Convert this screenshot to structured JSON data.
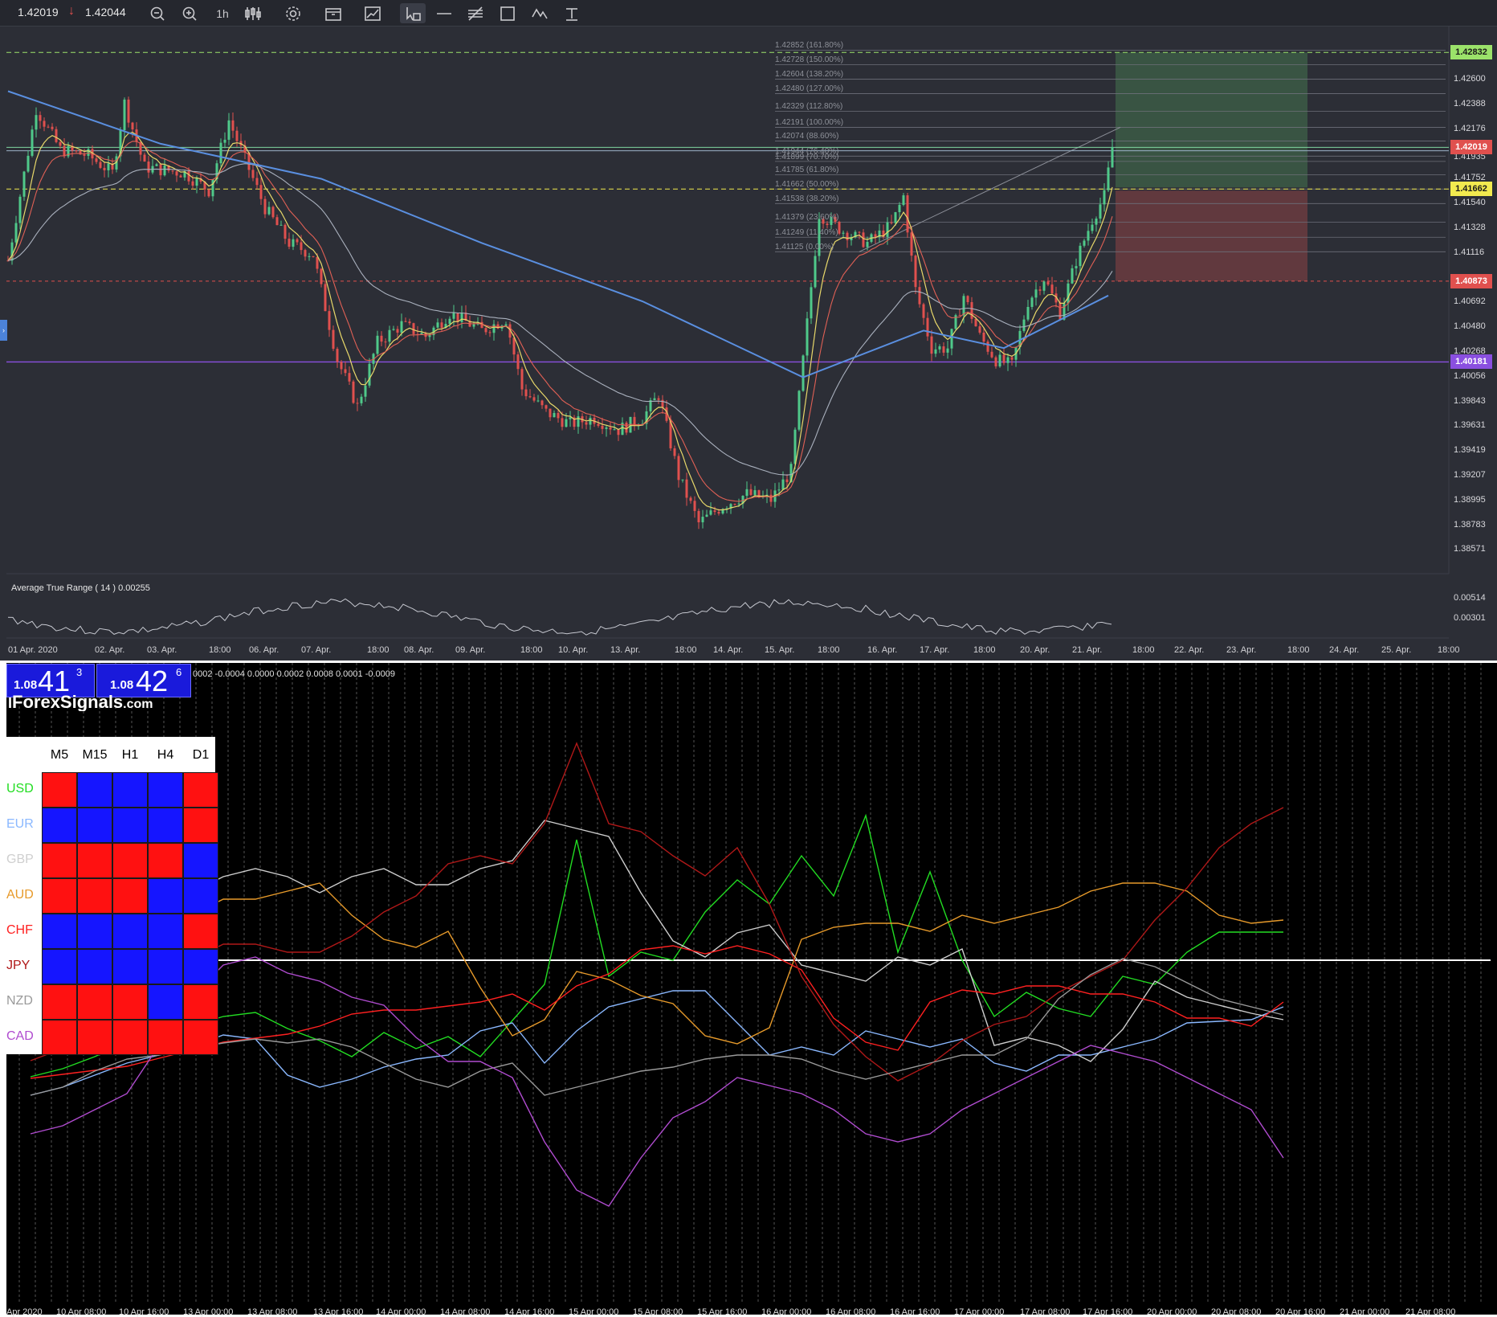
{
  "toolbar": {
    "bid": "1.42019",
    "ask": "1.42044",
    "timeframe": "1h",
    "icons": [
      "zoom-out-icon",
      "zoom-in-icon",
      "candles-icon",
      "settings-icon",
      "calendar-icon",
      "chart-image-icon",
      "cursor-icon",
      "horizontal-line-icon",
      "parallel-lines-icon",
      "rectangle-icon",
      "wave-icon",
      "text-icon"
    ]
  },
  "price_axis": [
    "1.42600",
    "1.42388",
    "1.42176",
    "1.41935",
    "1.41752",
    "1.41540",
    "1.41328",
    "1.41116",
    "1.40692",
    "1.40480",
    "1.40268",
    "1.40056",
    "1.39843",
    "1.39631",
    "1.39419",
    "1.39207",
    "1.38995",
    "1.38783",
    "1.38571"
  ],
  "price_tags": [
    {
      "value": "1.42832",
      "bg": "#9be26a",
      "fg": "#1a1a1a"
    },
    {
      "value": "1.42019",
      "bg": "#e0504e",
      "fg": "#ffffff"
    },
    {
      "value": "1.41662",
      "bg": "#f2ea4f",
      "fg": "#1a1a1a"
    },
    {
      "value": "1.40873",
      "bg": "#e0504e",
      "fg": "#ffffff"
    },
    {
      "value": "1.40181",
      "bg": "#8a4fe0",
      "fg": "#ffffff"
    }
  ],
  "fib_levels": [
    "1.42852 (161.80%)",
    "1.42728 (150.00%)",
    "1.42604 (138.20%)",
    "1.42480 (127.00%)",
    "1.42329 (112.80%)",
    "1.42191 (100.00%)",
    "1.42074 (88.60%)",
    "1.41944 (76.40%)",
    "1.41899 (70.70%)",
    "1.41785 (61.80%)",
    "1.41662 (50.00%)",
    "1.41538 (38.20%)",
    "1.41379 (23.60%)",
    "1.41249 (11.40%)",
    "1.41125 (0.00%)"
  ],
  "atr": {
    "title": "Average True Range ( 14 ) 0.00255",
    "axis": [
      "0.00514",
      "0.00301"
    ]
  },
  "date_axis": [
    "01 Apr. 2020",
    "02. Apr.",
    "03. Apr.",
    "18:00",
    "06. Apr.",
    "07. Apr.",
    "18:00",
    "08. Apr.",
    "09. Apr.",
    "18:00",
    "10. Apr.",
    "13. Apr.",
    "18:00",
    "14. Apr.",
    "15. Apr.",
    "18:00",
    "16. Apr.",
    "17. Apr.",
    "18:00",
    "20. Apr.",
    "21. Apr.",
    "18:00",
    "22. Apr.",
    "23. Apr.",
    "18:00",
    "24. Apr.",
    "25. Apr.",
    "18:00"
  ],
  "colors": {
    "chart_bg": "#2c2e36",
    "bull": "#4fc98a",
    "bear": "#e0504e",
    "ma_blue": "#5a8fe0",
    "ma_yellow": "#e8d86a",
    "ma_red": "#e06055",
    "ma_grey": "#a9b0bd"
  },
  "mt4": {
    "quote_left": {
      "small": "1.08",
      "big": "41",
      "sup": "3"
    },
    "quote_right": {
      "small": "1.08",
      "big": "42",
      "sup": "6"
    },
    "values_row": "0002 -0.0004 0.0000 0.0002 0.0008 0.0001 -0.0009",
    "logo": "ForexSignals",
    "logo_suffix": ".com",
    "timeframes": [
      "M5",
      "M15",
      "H1",
      "H4",
      "D1"
    ],
    "currencies": [
      {
        "name": "USD",
        "color": "#22dd22",
        "cells": [
          "red",
          "blue",
          "blue",
          "blue",
          "red"
        ]
      },
      {
        "name": "EUR",
        "color": "#8ab8ff",
        "cells": [
          "blue",
          "blue",
          "blue",
          "blue",
          "red"
        ]
      },
      {
        "name": "GBP",
        "color": "#cfcfcf",
        "cells": [
          "red",
          "red",
          "red",
          "red",
          "blue"
        ]
      },
      {
        "name": "AUD",
        "color": "#e79a2a",
        "cells": [
          "red",
          "red",
          "red",
          "blue",
          "blue"
        ]
      },
      {
        "name": "CHF",
        "color": "#ff2020",
        "cells": [
          "blue",
          "blue",
          "blue",
          "blue",
          "red"
        ]
      },
      {
        "name": "JPY",
        "color": "#b01818",
        "cells": [
          "blue",
          "blue",
          "blue",
          "blue",
          "blue"
        ]
      },
      {
        "name": "NZD",
        "color": "#9a9a9a",
        "cells": [
          "red",
          "red",
          "red",
          "blue",
          "red"
        ]
      },
      {
        "name": "CAD",
        "color": "#b04cd0",
        "cells": [
          "red",
          "red",
          "red",
          "red",
          "red"
        ]
      }
    ],
    "x_axis": [
      "Apr 2020",
      "10 Apr 08:00",
      "10 Apr 16:00",
      "13 Apr 00:00",
      "13 Apr 08:00",
      "13 Apr 16:00",
      "14 Apr 00:00",
      "14 Apr 08:00",
      "14 Apr 16:00",
      "15 Apr 00:00",
      "15 Apr 08:00",
      "15 Apr 16:00",
      "16 Apr 00:00",
      "16 Apr 08:00",
      "16 Apr 16:00",
      "17 Apr 00:00",
      "17 Apr 08:00",
      "17 Apr 16:00",
      "20 Apr 00:00",
      "20 Apr 08:00",
      "20 Apr 16:00",
      "21 Apr 00:00",
      "21 Apr 08:00"
    ]
  }
}
